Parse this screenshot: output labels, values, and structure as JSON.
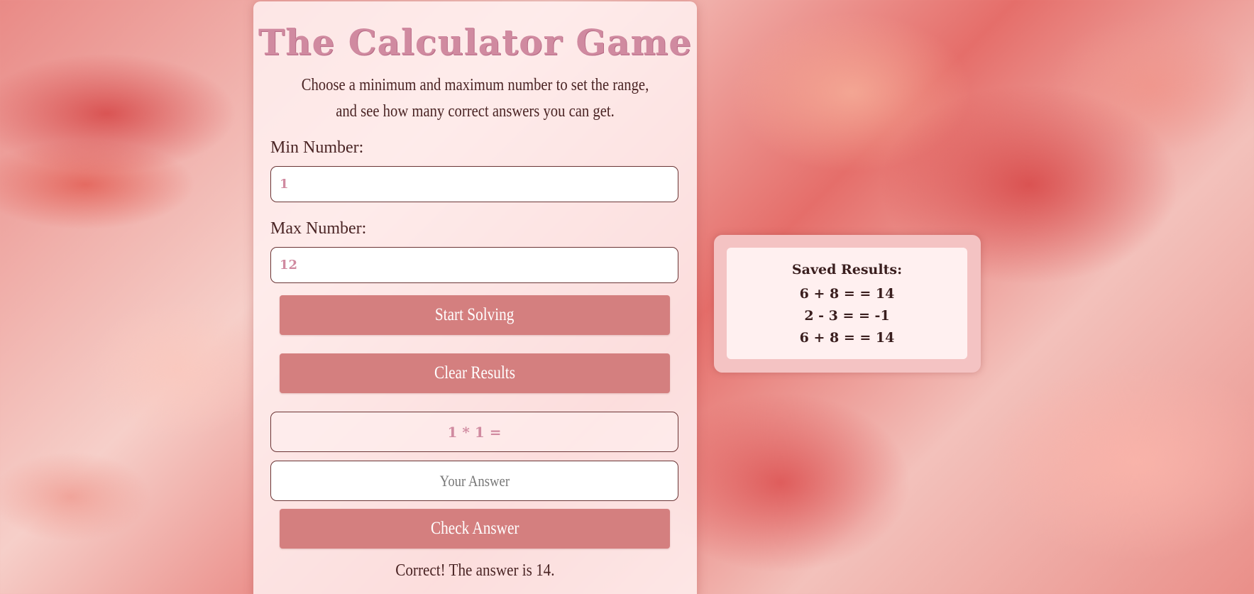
{
  "game": {
    "title": "The Calculator Game",
    "subtitle_line1": "Choose a minimum and maximum number to set the range,",
    "subtitle_line2": "and see how many correct answers you can get.",
    "min_label": "Min Number:",
    "min_value": "1",
    "max_label": "Max Number:",
    "max_value": "12",
    "start_button": "Start Solving",
    "clear_button": "Clear Results",
    "problem": "1 * 1 =",
    "answer_placeholder": "Your Answer",
    "check_button": "Check Answer",
    "feedback": "Correct! The answer is 14."
  },
  "results": {
    "heading": "Saved Results:",
    "items": [
      "6 + 8 = = 14",
      "2 - 3 = = -1",
      "6 + 8 = = 14"
    ]
  },
  "colors": {
    "accent": "#d47f7f",
    "title": "#d08aa0",
    "text": "#4a2424",
    "card": "#fff0f0",
    "results_frame": "#f4c3c3"
  }
}
